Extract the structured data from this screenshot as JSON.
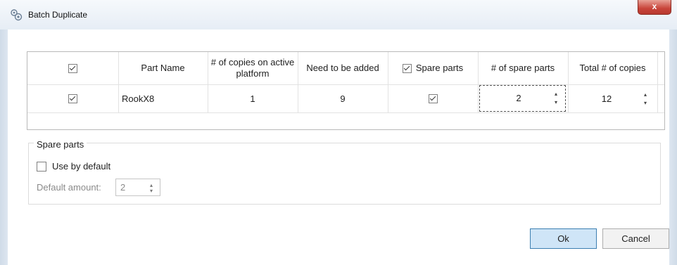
{
  "window": {
    "title": "Batch Duplicate",
    "close_label": "x"
  },
  "grid": {
    "headers": {
      "select_all_checked": true,
      "part_name": "Part Name",
      "copies_active": "# of copies on active platform",
      "need_added": "Need to be added",
      "spare_parts": "Spare parts",
      "spare_parts_checked": true,
      "num_spare": "# of spare parts",
      "total_copies": "Total # of copies"
    },
    "rows": [
      {
        "selected": true,
        "part_name": "RookX8",
        "copies_active": "1",
        "need_added": "9",
        "spare_parts": true,
        "num_spare": "2",
        "total_copies": "12"
      }
    ]
  },
  "spare_group": {
    "title": "Spare parts",
    "use_by_default_label": "Use by default",
    "use_by_default_checked": false,
    "default_amount_label": "Default amount:",
    "default_amount_value": "2"
  },
  "buttons": {
    "ok": "Ok",
    "cancel": "Cancel"
  },
  "icons": {
    "title_icon": "batch-duplicate-gears-icon",
    "spinner_up": "▴",
    "spinner_down": "▾"
  }
}
